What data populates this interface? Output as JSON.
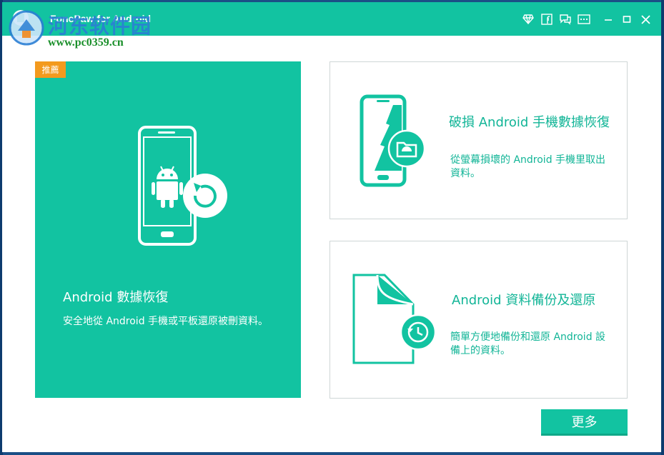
{
  "window": {
    "title": "FonePaw for Android"
  },
  "watermark": {
    "site_name": "河东软件园",
    "url": "www.pc0359.cn"
  },
  "titlebar_icons": [
    "diamond-icon",
    "facebook-icon",
    "feedback-icon",
    "menu-icon",
    "minimize-icon",
    "maximize-icon",
    "close-icon"
  ],
  "main_card": {
    "badge": "推薦",
    "title": "Android 數據恢復",
    "description": "安全地從 Android 手機或平板還原被刪資料。"
  },
  "card_broken": {
    "title": "破損 Android 手機數據恢復",
    "description": "從螢幕損壞的 Android 手機里取出資料。"
  },
  "card_backup": {
    "title": "Android 資料備份及還原",
    "description": "簡單方便地備份和還原 Android 設備上的資料。"
  },
  "more_button": {
    "label": "更多"
  },
  "colors": {
    "accent": "#12c3a1",
    "badge": "#f39a1e",
    "text_accent": "#12b597"
  }
}
